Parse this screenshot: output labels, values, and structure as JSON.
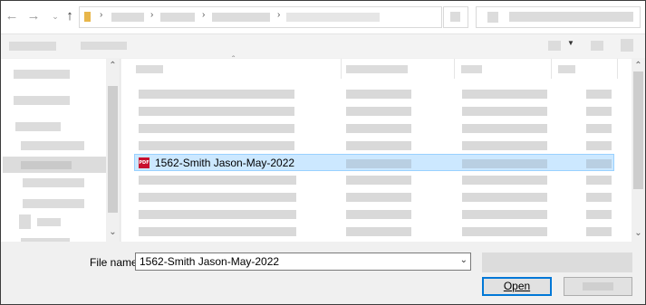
{
  "dialog": {
    "file_name_label": "File name:",
    "file_name_value": "1562-Smith Jason-May-2022",
    "open_label": "Open"
  },
  "file_list": {
    "selected_file": "1562-Smith Jason-May-2022",
    "selected_icon": "pdf-icon",
    "icon_text": "PDF"
  },
  "icons": {
    "back": "back-arrow-icon",
    "forward": "forward-arrow-icon",
    "recent": "chevron-down-icon",
    "up": "up-arrow-icon",
    "folder": "folder-icon"
  },
  "colors": {
    "selection_background": "#cce8ff",
    "selection_border": "#99d1ff",
    "default_button_border": "#0078d7",
    "pdf_icon": "#c8102e"
  }
}
